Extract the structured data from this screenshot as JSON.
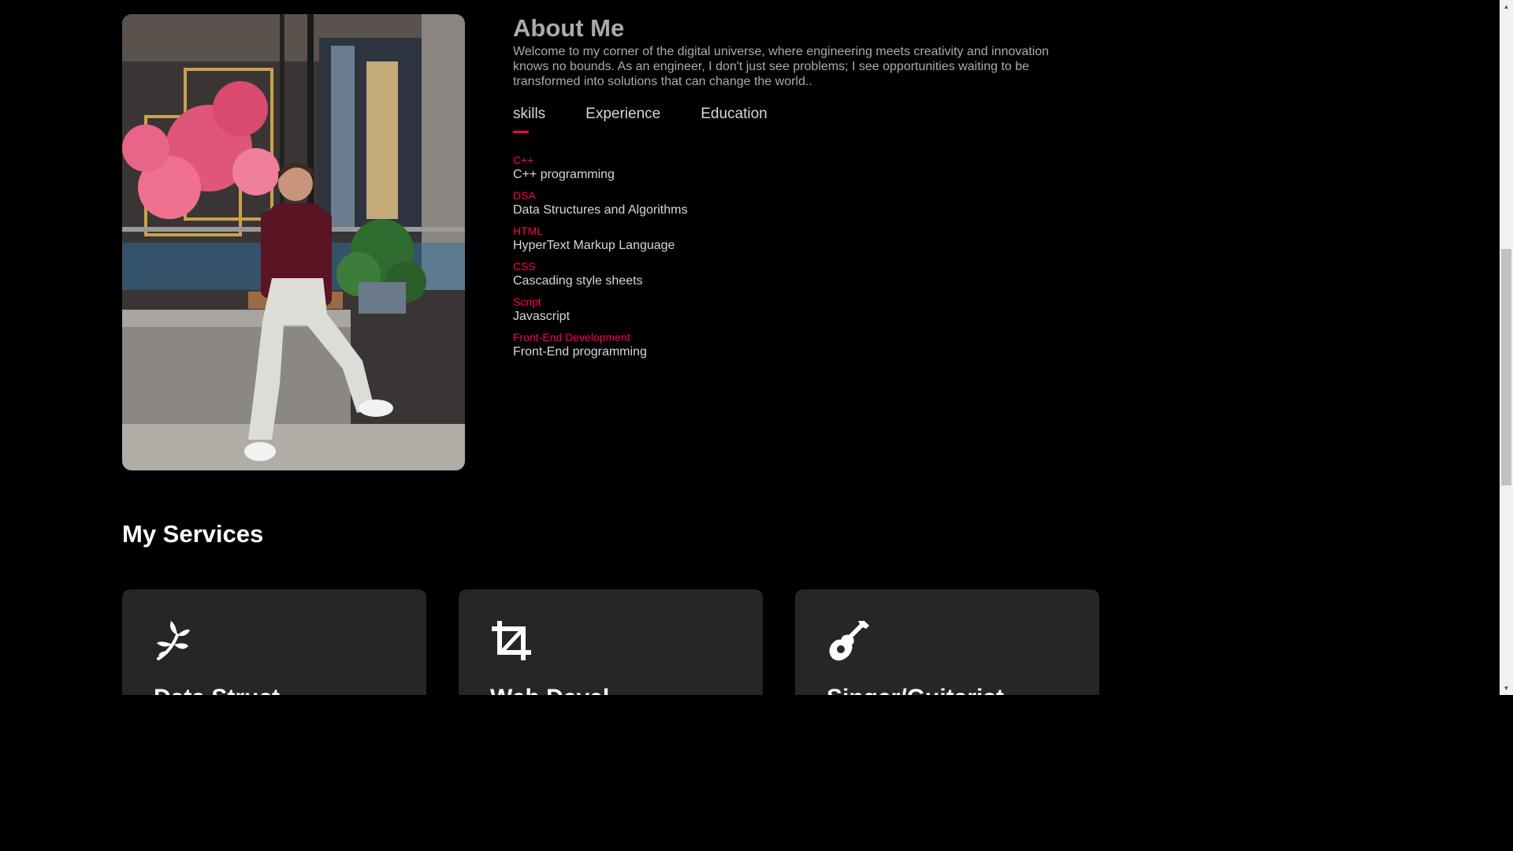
{
  "about": {
    "title": "About Me",
    "text": "Welcome to my corner of the digital universe, where engineering meets creativity and innovation knows no bounds. As an engineer, I don't just see problems; I see opportunities waiting to be transformed into solutions that can change the world..",
    "tabs": [
      {
        "label": "skills",
        "active": true
      },
      {
        "label": "Experience",
        "active": false
      },
      {
        "label": "Education",
        "active": false
      }
    ],
    "skills": [
      {
        "name": "C++",
        "desc": "C++ programming"
      },
      {
        "name": "DSA",
        "desc": "Data Structures and Algorithms"
      },
      {
        "name": "HTML",
        "desc": "HyperText Markup Language"
      },
      {
        "name": "CSS",
        "desc": "Cascading style sheets"
      },
      {
        "name": "Script",
        "desc": "Javascript"
      },
      {
        "name": "Front-End Development",
        "desc": "Front-End programming"
      }
    ]
  },
  "services": {
    "title": "My Services",
    "cards": [
      {
        "icon": "leaf-icon",
        "title": "Data Struct..."
      },
      {
        "icon": "crop-icon",
        "title": "Web Devel..."
      },
      {
        "icon": "guitar-icon",
        "title": "Singer/Guitarist"
      }
    ]
  },
  "colors": {
    "accent": "#ff004f",
    "background": "#000000",
    "card": "#262626",
    "muted_text": "#ababab"
  },
  "scrollbar": {
    "up_arrow": "▲",
    "down_arrow": "▼"
  }
}
